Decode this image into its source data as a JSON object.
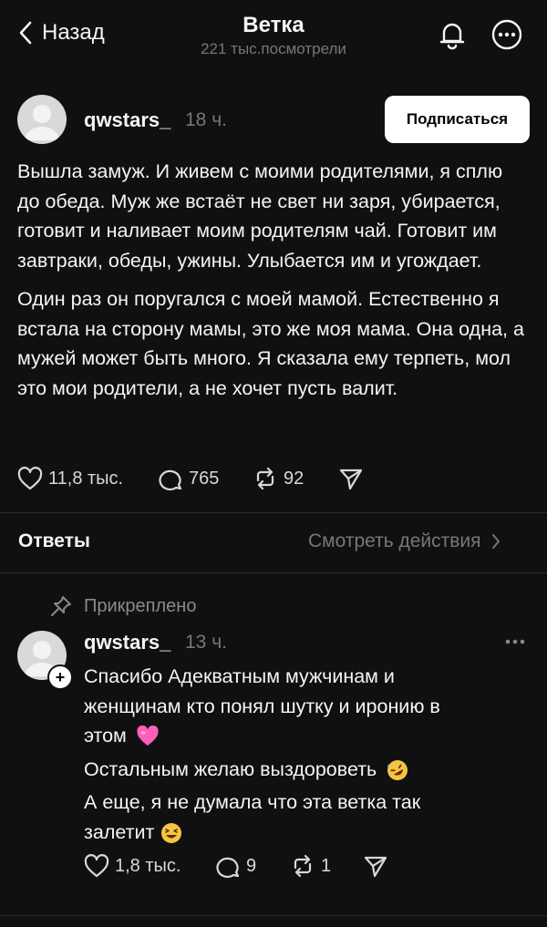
{
  "header": {
    "back_label": "Назад",
    "title": "Ветка",
    "views": "221 тыс.посмотрели"
  },
  "post": {
    "author": "qwstars_",
    "time": "18 ч.",
    "subscribe_label": "Подписаться",
    "paragraphs": [
      "Вышла замуж. И живем с моими родителями, я сплю до обеда. Муж же встаёт не свет ни заря, убирается, готовит и наливает моим родителям чай. Готовит им завтраки, обеды, ужины. Улыбается им и угождает.",
      "Один раз он поругался с моей мамой. Естественно я встала на сторону мамы, это же моя мама. Она одна, а мужей может быть много. Я сказала ему терпеть, мол это мои родители, а не хочет пусть валит."
    ],
    "likes": "11,8 тыс.",
    "comments": "765",
    "reposts": "92"
  },
  "replies_section": {
    "title": "Ответы",
    "see_actions": "Смотреть действия"
  },
  "reply": {
    "pinned_label": "Прикреплено",
    "author": "qwstars_",
    "time": "13 ч.",
    "line1": "Спасибо Адекватным мужчинам и",
    "line2": "женщинам кто понял шутку и иронию в",
    "line3": "этом",
    "line4": "Остальным желаю выздороветь",
    "line5": "А еще, я не думала что эта ветка так",
    "line6": "залетит",
    "likes": "1,8 тыс.",
    "comments": "9",
    "reposts": "1"
  },
  "icons": [
    "back-chevron-icon",
    "bell-icon",
    "more-icon",
    "heart-icon",
    "comment-icon",
    "repost-icon",
    "share-icon",
    "pin-icon",
    "chevron-right-icon",
    "ellipsis-icon",
    "heart-emoji-icon",
    "rofl-emoji-icon",
    "laughing-emoji-icon"
  ],
  "colors": {
    "background": "#101010",
    "text": "#f3f5f7",
    "muted": "#777777",
    "button_bg": "#ffffff"
  }
}
